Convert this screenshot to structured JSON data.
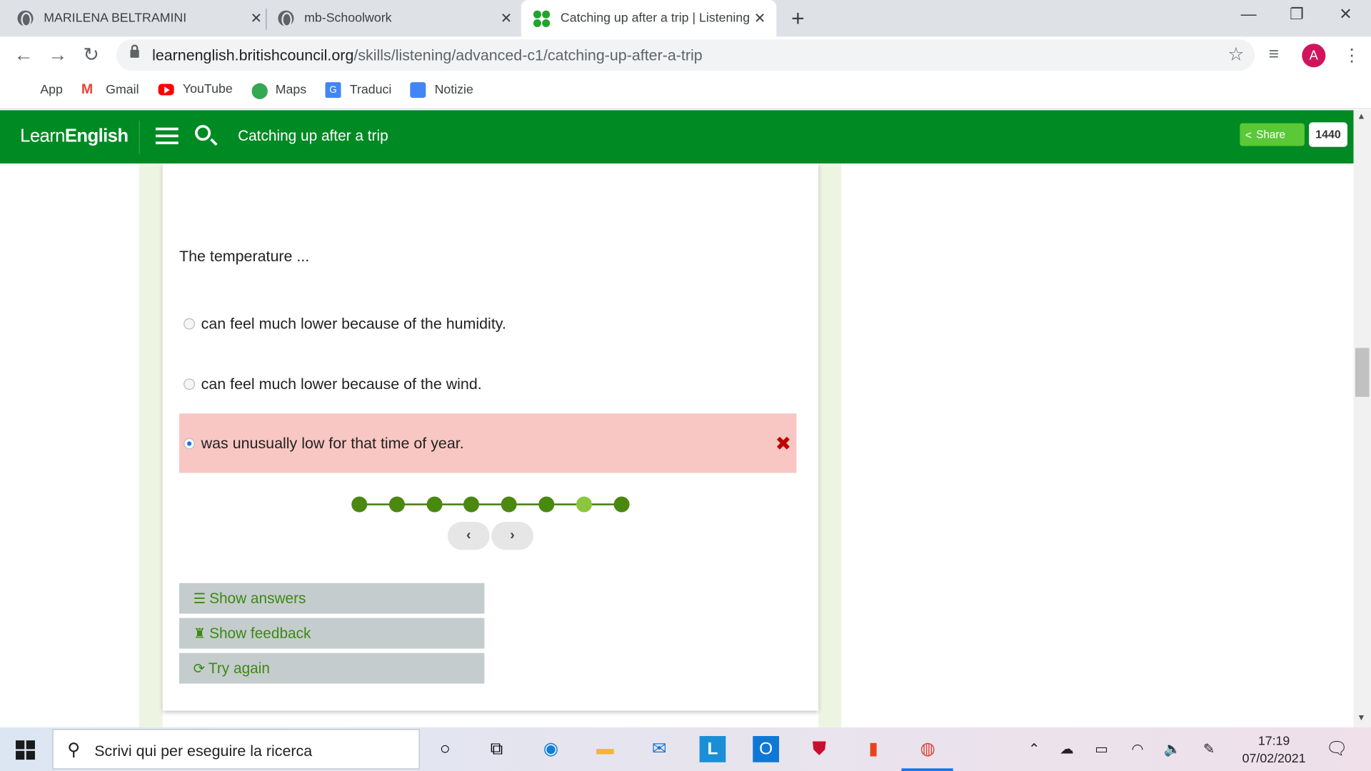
{
  "browser": {
    "tabs": [
      {
        "title": "MARILENA BELTRAMINI",
        "active": false
      },
      {
        "title": "mb-Schoolwork",
        "active": false
      },
      {
        "title": "Catching up after a trip | Listening",
        "active": true
      }
    ],
    "url_host": "learnenglish.britishcouncil.org",
    "url_path": "/skills/listening/advanced-c1/catching-up-after-a-trip",
    "profile_initial": "A",
    "bookmarks": [
      "App",
      "Gmail",
      "YouTube",
      "Maps",
      "Traduci",
      "Notizie"
    ]
  },
  "site": {
    "logo_light": "Learn",
    "logo_bold": "English",
    "page_title": "Catching up after a trip",
    "share_label": "Share",
    "share_count": "1440",
    "accent": "#008a23"
  },
  "quiz": {
    "question": "The temperature ...",
    "options": [
      {
        "label": "can feel much lower because of the humidity.",
        "selected": false,
        "state": "none"
      },
      {
        "label": "can feel much lower because of the wind.",
        "selected": false,
        "state": "none"
      },
      {
        "label": "was unusually low for that time of year.",
        "selected": true,
        "state": "wrong"
      }
    ],
    "wrong_mark": "✖",
    "progress_total": 8,
    "progress_current": 7,
    "prev_icon": "chevron-left-icon",
    "next_icon": "chevron-right-icon",
    "buttons": [
      {
        "label": "Show answers",
        "icon": "list-icon"
      },
      {
        "label": "Show feedback",
        "icon": "chess-rook-icon"
      },
      {
        "label": "Try again",
        "icon": "refresh-icon"
      }
    ]
  },
  "taskbar": {
    "search_placeholder": "Scrivi qui per eseguire la ricerca",
    "time": "17:19",
    "date": "07/02/2021"
  }
}
